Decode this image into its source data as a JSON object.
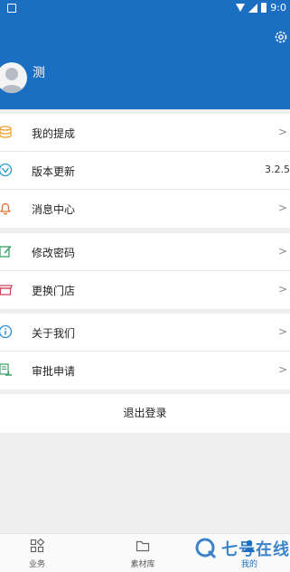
{
  "status": {
    "time": "9:0"
  },
  "profile": {
    "username": "测"
  },
  "menu_groups": [
    [
      {
        "label": "我的提成",
        "icon": "coins-icon",
        "trailing": ">"
      },
      {
        "label": "版本更新",
        "icon": "version-update-icon",
        "trailing": "3.2.5"
      },
      {
        "label": "消息中心",
        "icon": "bell-icon",
        "trailing": ">"
      }
    ],
    [
      {
        "label": "修改密码",
        "icon": "edit-password-icon",
        "trailing": ">"
      },
      {
        "label": "更换门店",
        "icon": "store-icon",
        "trailing": ">"
      }
    ],
    [
      {
        "label": "关于我们",
        "icon": "info-icon",
        "trailing": ">"
      },
      {
        "label": "审批申请",
        "icon": "approval-icon",
        "trailing": ">"
      }
    ]
  ],
  "logout": {
    "label": "退出登录"
  },
  "tabs": [
    {
      "label": "业务",
      "icon": "grid-icon"
    },
    {
      "label": "素材库",
      "icon": "folder-icon"
    },
    {
      "label": "我的",
      "icon": "profile-icon"
    }
  ],
  "watermark": {
    "text": "七号在线",
    "letter": "Q"
  },
  "colors": {
    "primary": "#1b6fc2",
    "background": "#efefef"
  }
}
